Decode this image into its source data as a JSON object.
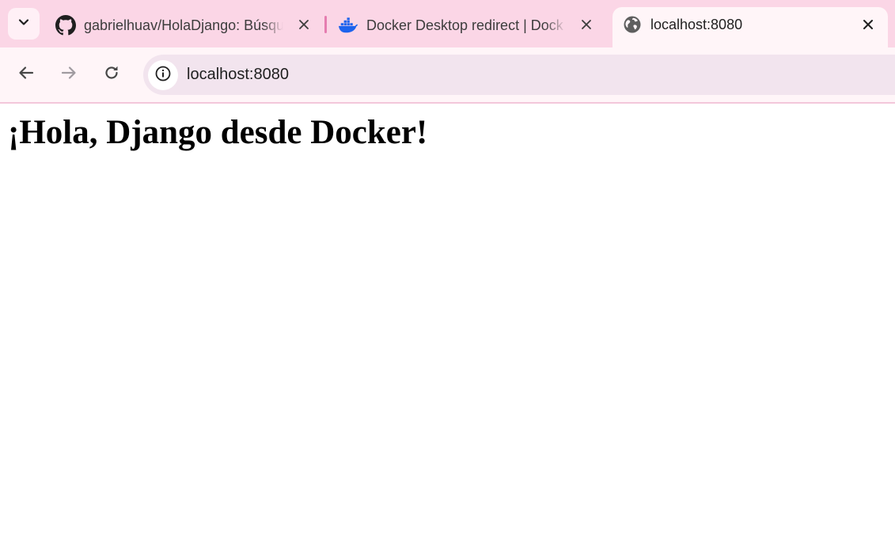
{
  "browser": {
    "tabs": [
      {
        "title": "gabrielhuav/HolaDjango: Búsqu",
        "favicon": "github-icon",
        "active": false
      },
      {
        "title": "Docker Desktop redirect | Dock",
        "favicon": "docker-icon",
        "active": false
      },
      {
        "title": "localhost:8080",
        "favicon": "globe-icon",
        "active": true
      }
    ],
    "address_bar": {
      "url": "localhost:8080",
      "site_info_icon": "info-icon"
    },
    "colors": {
      "tabstrip": "#fbd6e6",
      "active_tab": "#fff5f8",
      "omnibox": "#f2e4ee",
      "docker_blue": "#1d63ed"
    }
  },
  "page": {
    "heading": "¡Hola, Django desde Docker!"
  }
}
